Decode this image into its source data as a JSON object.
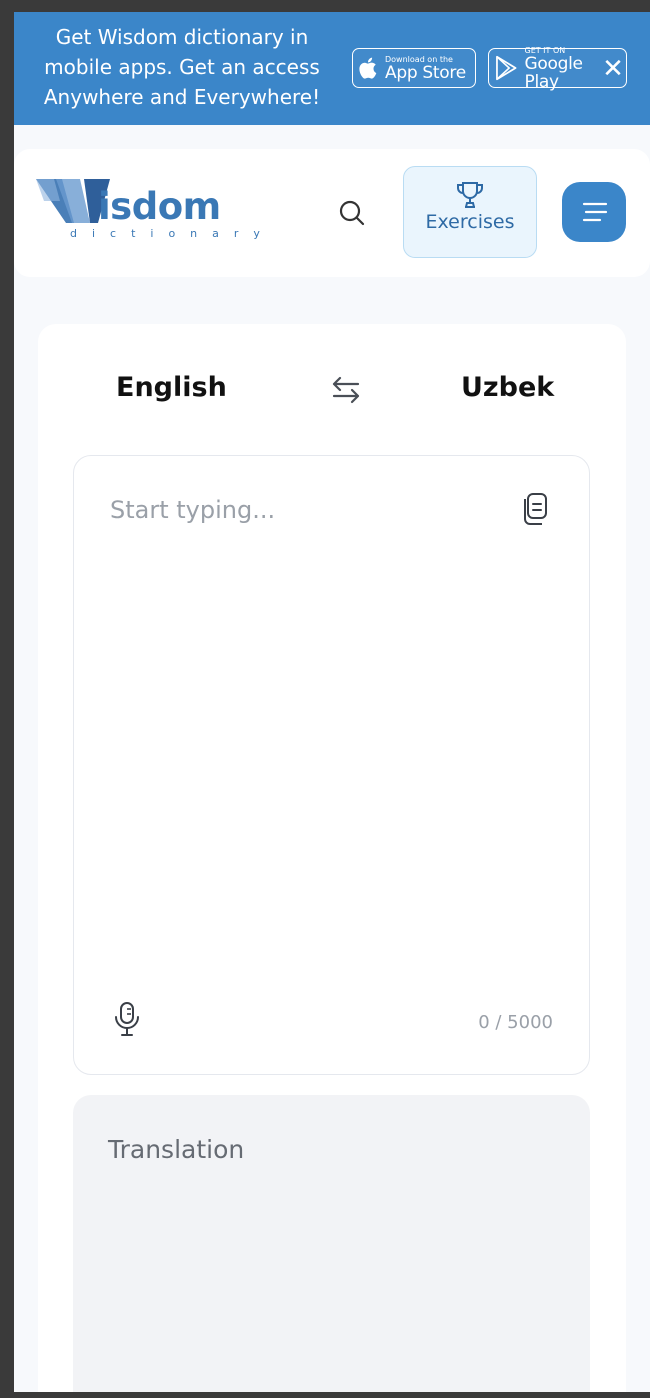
{
  "banner": {
    "text": "Get Wisdom dictionary in mobile apps. Get an access Anywhere and Everywhere!",
    "app_store": {
      "small": "Download on the",
      "big": "App Store"
    },
    "google_play": {
      "small": "GET IT ON",
      "big": "Google Play"
    },
    "close_icon": "close-icon",
    "background": "#3b86c9"
  },
  "header": {
    "logo": {
      "word": "isdom",
      "sub": "dictionary"
    },
    "search_icon": "search-icon",
    "exercises_label": "Exercises",
    "menu_icon": "menu-icon"
  },
  "translator": {
    "source_language": "English",
    "target_language": "Uzbek",
    "swap_icon": "swap-icon",
    "input": {
      "placeholder": "Start typing...",
      "value": "",
      "counter": "0 / 5000"
    },
    "output_label": "Translation"
  },
  "colors": {
    "accent": "#3b86c9",
    "exercises_bg": "#eaf5fd"
  }
}
